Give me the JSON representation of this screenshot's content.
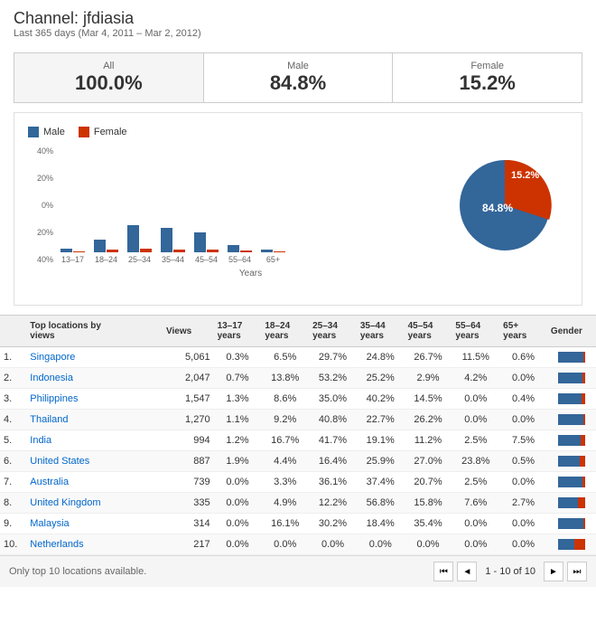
{
  "header": {
    "title": "Channel: jfdiasia",
    "subtitle": "Last 365 days (Mar 4, 2011 – Mar 2, 2012)"
  },
  "gender_tabs": [
    {
      "label": "All",
      "value": "100.0%"
    },
    {
      "label": "Male",
      "value": "84.8%"
    },
    {
      "label": "Female",
      "value": "15.2%"
    }
  ],
  "chart": {
    "legend_male": "Male",
    "legend_female": "Female",
    "x_title": "Years",
    "y_labels": [
      "40%",
      "20%",
      "0%",
      "20%",
      "40%"
    ],
    "pie_male_pct": "84.8%",
    "pie_female_pct": "15.2%",
    "bars": [
      {
        "label": "13–17",
        "male_h": 4,
        "female_h": 1
      },
      {
        "label": "18–24",
        "male_h": 14,
        "female_h": 3
      },
      {
        "label": "25–34",
        "male_h": 30,
        "female_h": 4
      },
      {
        "label": "35–44",
        "male_h": 27,
        "female_h": 3
      },
      {
        "label": "45–54",
        "male_h": 22,
        "female_h": 3
      },
      {
        "label": "55–64",
        "male_h": 8,
        "female_h": 2
      },
      {
        "label": "65+",
        "male_h": 3,
        "female_h": 1
      }
    ]
  },
  "table": {
    "headers": [
      "",
      "Top locations by views",
      "Views",
      "13–17 years",
      "18–24 years",
      "25–34 years",
      "35–44 years",
      "45–54 years",
      "55–64 years",
      "65+ years",
      "Gender"
    ],
    "rows": [
      {
        "rank": "1.",
        "country": "Singapore",
        "views": "5,061",
        "a1317": "0.3%",
        "a1824": "6.5%",
        "a2534": "29.7%",
        "a3544": "24.8%",
        "a4554": "26.7%",
        "a5564": "11.5%",
        "a65": "0.6%",
        "male_pct": 95,
        "female_pct": 5
      },
      {
        "rank": "2.",
        "country": "Indonesia",
        "views": "2,047",
        "a1317": "0.7%",
        "a1824": "13.8%",
        "a2534": "53.2%",
        "a3544": "25.2%",
        "a4554": "2.9%",
        "a5564": "4.2%",
        "a65": "0.0%",
        "male_pct": 90,
        "female_pct": 10
      },
      {
        "rank": "3.",
        "country": "Philippines",
        "views": "1,547",
        "a1317": "1.3%",
        "a1824": "8.6%",
        "a2534": "35.0%",
        "a3544": "40.2%",
        "a4554": "14.5%",
        "a5564": "0.0%",
        "a65": "0.4%",
        "male_pct": 88,
        "female_pct": 12
      },
      {
        "rank": "4.",
        "country": "Thailand",
        "views": "1,270",
        "a1317": "1.1%",
        "a1824": "9.2%",
        "a2534": "40.8%",
        "a3544": "22.7%",
        "a4554": "26.2%",
        "a5564": "0.0%",
        "a65": "0.0%",
        "male_pct": 92,
        "female_pct": 8
      },
      {
        "rank": "5.",
        "country": "India",
        "views": "994",
        "a1317": "1.2%",
        "a1824": "16.7%",
        "a2534": "41.7%",
        "a3544": "19.1%",
        "a4554": "11.2%",
        "a5564": "2.5%",
        "a65": "7.5%",
        "male_pct": 85,
        "female_pct": 15
      },
      {
        "rank": "6.",
        "country": "United States",
        "views": "887",
        "a1317": "1.9%",
        "a1824": "4.4%",
        "a2534": "16.4%",
        "a3544": "25.9%",
        "a4554": "27.0%",
        "a5564": "23.8%",
        "a65": "0.5%",
        "male_pct": 80,
        "female_pct": 20
      },
      {
        "rank": "7.",
        "country": "Australia",
        "views": "739",
        "a1317": "0.0%",
        "a1824": "3.3%",
        "a2534": "36.1%",
        "a3544": "37.4%",
        "a4554": "20.7%",
        "a5564": "2.5%",
        "a65": "0.0%",
        "male_pct": 90,
        "female_pct": 10
      },
      {
        "rank": "8.",
        "country": "United Kingdom",
        "views": "335",
        "a1317": "0.0%",
        "a1824": "4.9%",
        "a2534": "12.2%",
        "a3544": "56.8%",
        "a4554": "15.8%",
        "a5564": "7.6%",
        "a65": "2.7%",
        "male_pct": 75,
        "female_pct": 25
      },
      {
        "rank": "9.",
        "country": "Malaysia",
        "views": "314",
        "a1317": "0.0%",
        "a1824": "16.1%",
        "a2534": "30.2%",
        "a3544": "18.4%",
        "a4554": "35.4%",
        "a5564": "0.0%",
        "a65": "0.0%",
        "male_pct": 93,
        "female_pct": 7
      },
      {
        "rank": "10.",
        "country": "Netherlands",
        "views": "217",
        "a1317": "0.0%",
        "a1824": "0.0%",
        "a2534": "0.0%",
        "a3544": "0.0%",
        "a4554": "0.0%",
        "a5564": "0.0%",
        "a65": "0.0%",
        "male_pct": 60,
        "female_pct": 40
      }
    ]
  },
  "footer": {
    "note": "Only top 10 locations available.",
    "pagination": "1 - 10 of 10"
  }
}
